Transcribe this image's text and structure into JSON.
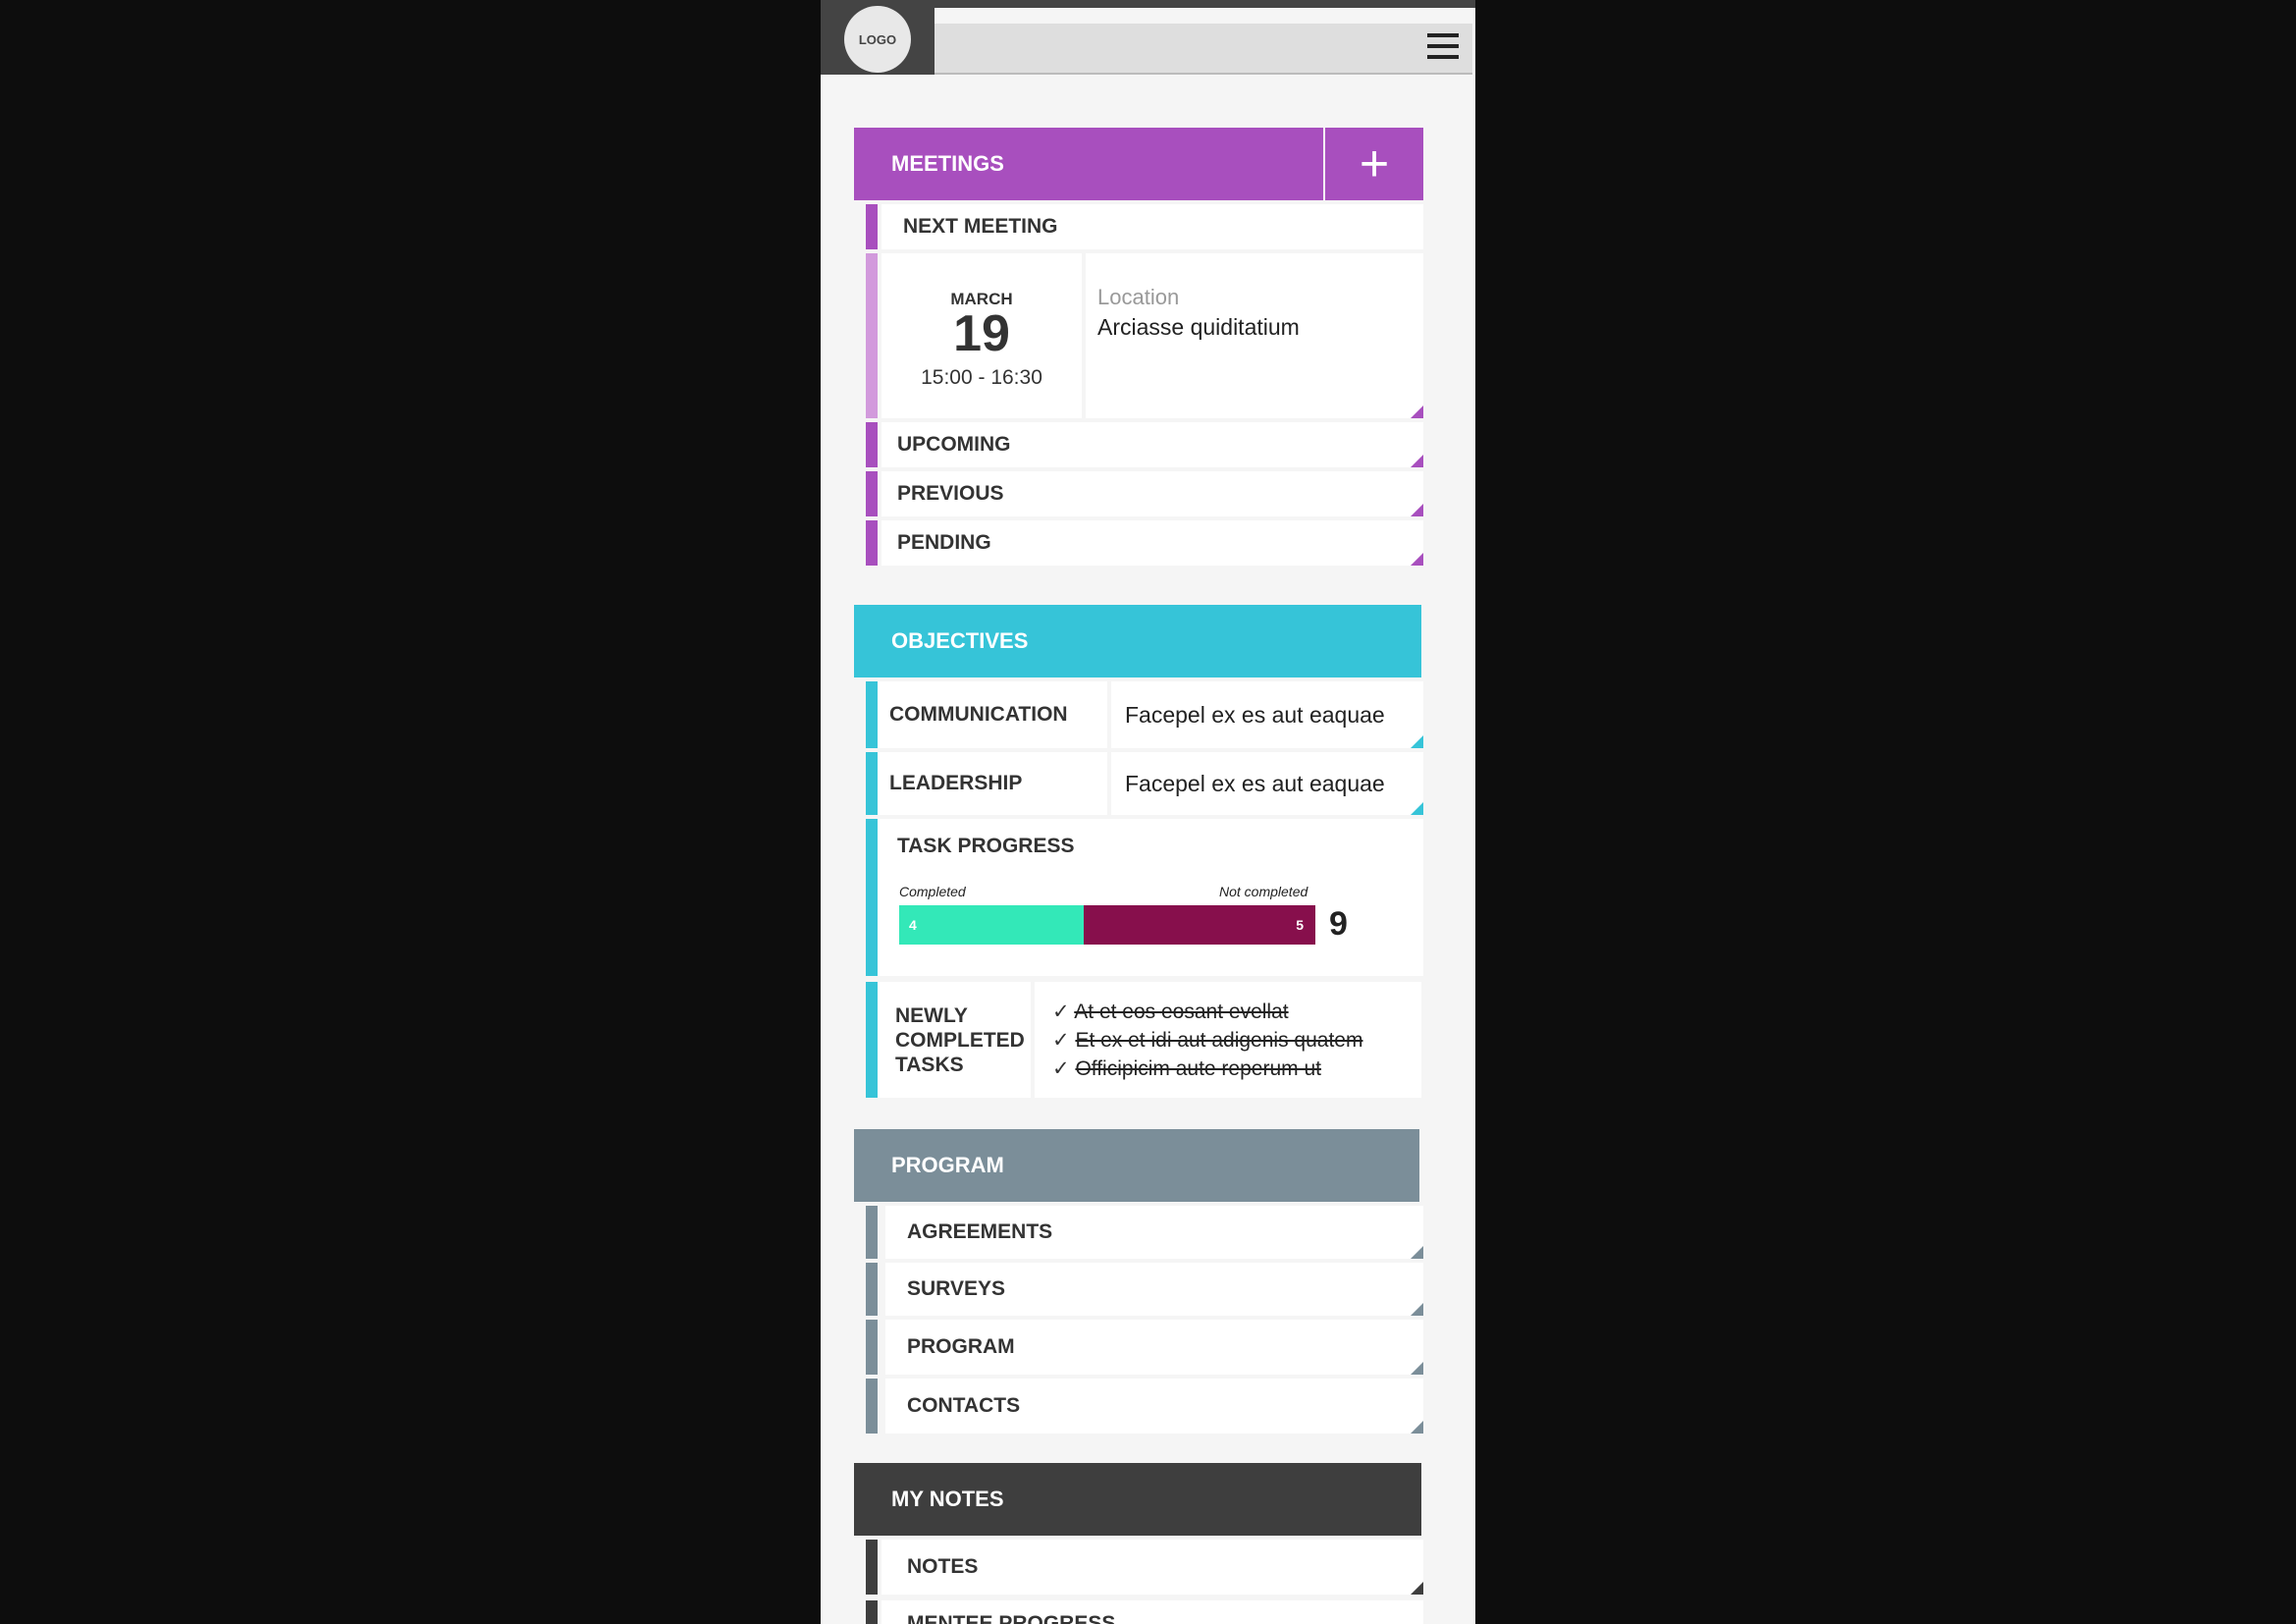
{
  "header": {
    "logo_text": "LOGO",
    "menu_icon": "hamburger-icon"
  },
  "meetings": {
    "title": "MEETINGS",
    "add_icon": "+",
    "next_label": "NEXT MEETING",
    "month": "MARCH",
    "day": "19",
    "time": "15:00 - 16:30",
    "location_label": "Location",
    "location_value": "Arciasse quiditatium",
    "items": [
      "UPCOMING",
      "PREVIOUS",
      "PENDING"
    ]
  },
  "objectives": {
    "title": "OBJECTIVES",
    "rows": [
      {
        "label": "COMMUNICATION",
        "value": "Facepel ex es aut eaquae"
      },
      {
        "label": "LEADERSHIP",
        "value": "Facepel ex es aut eaquae"
      }
    ],
    "task_progress": {
      "title": "TASK PROGRESS",
      "completed_label": "Completed",
      "not_completed_label": "Not completed",
      "completed": "4",
      "not_completed": "5",
      "total": "9"
    },
    "newly_completed": {
      "title_lines": [
        "NEWLY",
        "COMPLETED",
        "TASKS"
      ],
      "tasks": [
        "At et eos eosant evellat",
        "Et ex et idi aut adigenis quatem",
        "Officipicim aute reperum ut"
      ]
    }
  },
  "program": {
    "title": "PROGRAM",
    "items": [
      "AGREEMENTS",
      "SURVEYS",
      "PROGRAM",
      "CONTACTS"
    ]
  },
  "notes": {
    "title": "MY NOTES",
    "items": [
      "NOTES",
      "MENTEE PROGRESS"
    ]
  },
  "colors": {
    "meetings": "#a84fbe",
    "meetings_light": "#d29adc",
    "objectives": "#36c4d8",
    "program": "#7b8e99",
    "notes": "#3e3e3e",
    "completed": "#33e8b8",
    "not_completed": "#870f4c"
  }
}
